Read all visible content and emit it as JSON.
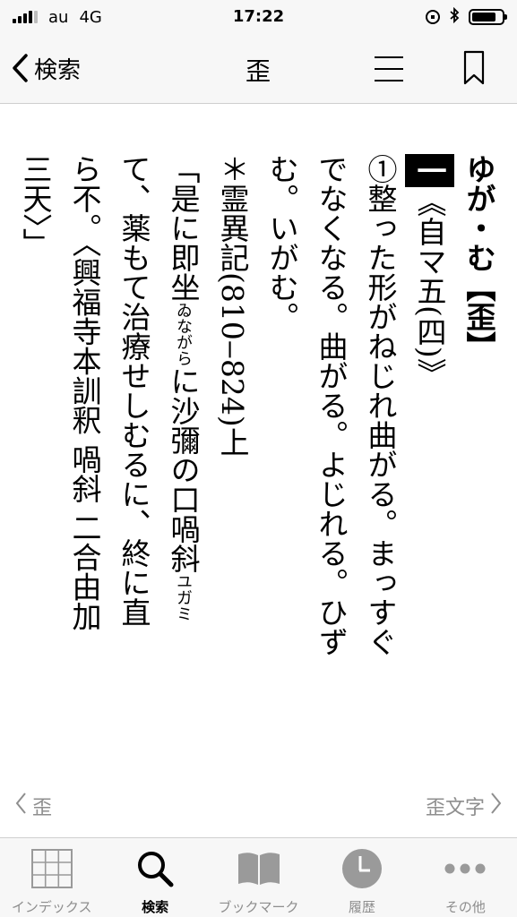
{
  "status_bar": {
    "carrier": "au",
    "network": "4G",
    "time": "17:22",
    "battery_level": 0.8
  },
  "nav": {
    "back_label": "検索",
    "title": "歪"
  },
  "entry": {
    "headword": "ゆが・む",
    "kanji": "【歪】",
    "sense_mark": "一",
    "source": "《自マ五(四)》",
    "definition_col1": "①整った形がねじれ曲がる。まっすぐ",
    "definition_col2": "でなくなる。曲がる。よじれる。ひず",
    "definition_col3": "む。いがむ。",
    "citation_marker": "＊",
    "citation_source": "霊異記(810‒824)上",
    "quote_col1_part1": "「是に即坐",
    "quote_col1_ruby1": "ゐながら",
    "quote_col1_part2": "に沙彌の口喎斜",
    "quote_col1_ruby2": "ユガミ",
    "quote_col2": "て、薬もて治療せしむるに、終に直",
    "quote_col3": "ら不。〈興福寺本訓釈 喎斜 二合由加",
    "quote_col4": "三天〉」"
  },
  "pager": {
    "prev_label": "歪",
    "next_label": "歪文字"
  },
  "tabs": [
    {
      "label": "インデックス",
      "icon": "grid-icon"
    },
    {
      "label": "検索",
      "icon": "search-icon"
    },
    {
      "label": "ブックマーク",
      "icon": "book-icon"
    },
    {
      "label": "履歴",
      "icon": "clock-icon"
    },
    {
      "label": "その他",
      "icon": "more-icon"
    }
  ],
  "colors": {
    "bar_bg": "#f7f7f7",
    "inactive_tab": "#8e8e8e",
    "active_tab": "#000000"
  }
}
